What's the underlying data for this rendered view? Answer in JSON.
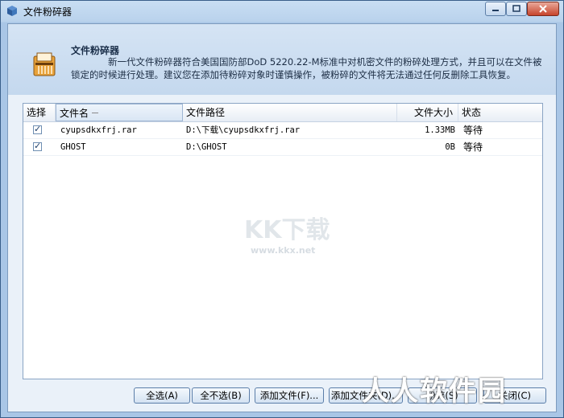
{
  "window": {
    "title": "文件粉碎器",
    "icon": "shredder-app-icon"
  },
  "header": {
    "title": "文件粉碎器",
    "description": "新一代文件粉碎器符合美国国防部DoD 5220.22-M标准中对机密文件的粉碎处理方式，并且可以在文件被锁定的时候进行处理。建议您在添加待粉碎对象时谨慎操作，被粉碎的文件将无法通过任何反删除工具恢复。"
  },
  "list": {
    "columns": [
      "选择",
      "文件名",
      "文件路径",
      "文件大小",
      "状态"
    ],
    "rows": [
      {
        "checked": true,
        "name": "cyupsdkxfrj.rar",
        "path": "D:\\下载\\cyupsdkxfrj.rar",
        "size": "1.33MB",
        "status": "等待"
      },
      {
        "checked": true,
        "name": "GHOST",
        "path": "D:\\GHOST",
        "size": "0B",
        "status": "等待"
      }
    ]
  },
  "watermark": {
    "text": "KK下载",
    "url": "www.kkx.net"
  },
  "buttons": {
    "select_all": "全选(A)",
    "select_none": "全不选(B)",
    "add_file": "添加文件(F)...",
    "add_folder": "添加文件夹(D)...",
    "shred": "粉碎(S)",
    "close": "关闭(C)"
  },
  "overlay_mark": "人人软件园"
}
